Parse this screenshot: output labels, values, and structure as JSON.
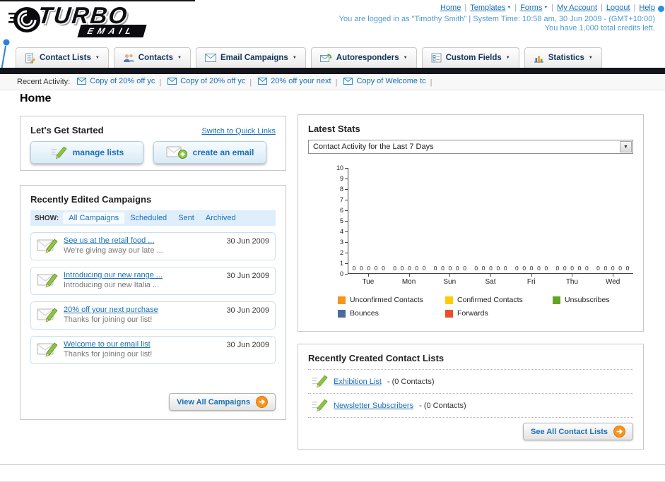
{
  "page_title": "Home",
  "header": {
    "logo_line1": "TURBO",
    "logo_line2": "EMAIL",
    "nav_links": [
      {
        "label": "Home",
        "caret": false
      },
      {
        "label": "Templates",
        "caret": true
      },
      {
        "label": "Forms",
        "caret": true
      },
      {
        "label": "My Account",
        "caret": false
      },
      {
        "label": "Logout",
        "caret": false
      },
      {
        "label": "Help",
        "caret": false
      }
    ],
    "status_line": "You are logged in as \"Timothy Smith\" | System Time: 10:58 am, 30 Jun 2009 - (GMT+10:00)",
    "credits_line": "You have 1,000 total credits left."
  },
  "main_nav": {
    "items": [
      {
        "label": "Contact Lists",
        "icon": "contact-lists"
      },
      {
        "label": "Contacts",
        "icon": "contacts"
      },
      {
        "label": "Email Campaigns",
        "icon": "email-campaigns"
      },
      {
        "label": "Autoresponders",
        "icon": "autoresponders"
      },
      {
        "label": "Custom Fields",
        "icon": "custom-fields"
      },
      {
        "label": "Statistics",
        "icon": "statistics"
      }
    ]
  },
  "recent_activity": {
    "label": "Recent Activity:",
    "items": [
      {
        "label": "Copy of 20% off yc",
        "icon": "envelope-small"
      },
      {
        "label": "Copy of 20% off yc",
        "icon": "envelope-small"
      },
      {
        "label": "20% off your next",
        "icon": "envelope-small"
      },
      {
        "label": "Copy of Welcome tc",
        "icon": "envelope-small"
      }
    ]
  },
  "get_started": {
    "title": "Let's Get Started",
    "switch_link": "Switch to Quick Links",
    "buttons": [
      {
        "label": "manage lists",
        "icon": "pencil-write"
      },
      {
        "label": "create an email",
        "icon": "envelope-plus"
      }
    ]
  },
  "campaigns": {
    "title": "Recently Edited Campaigns",
    "show_label": "SHOW:",
    "tabs": [
      "All Campaigns",
      "Scheduled",
      "Sent",
      "Archived"
    ],
    "active_tab": "All Campaigns",
    "items": [
      {
        "title": "See us at the retail food ...",
        "subtitle": "We're giving away our late ...",
        "date": "30 Jun 2009",
        "icon": "envelope-pencil"
      },
      {
        "title": "Introducing our new range ...",
        "subtitle": "Introducing our new Italia ...",
        "date": "30 Jun 2009",
        "icon": "envelope-pencil"
      },
      {
        "title": "20% off your next purchase",
        "subtitle": "Thanks for joining our list!",
        "date": "30 Jun 2009",
        "icon": "envelope-pencil"
      },
      {
        "title": "Welcome to our email list",
        "subtitle": "Thanks for joining our list!",
        "date": "30 Jun 2009",
        "icon": "envelope-pencil"
      }
    ],
    "view_all_label": "View All Campaigns"
  },
  "latest_stats": {
    "title": "Latest Stats",
    "dropdown_value": "Contact Activity for the Last 7 Days",
    "chart_data": {
      "type": "bar",
      "title": "Contact Activity for the Last 7 Days",
      "categories": [
        "Tue",
        "Mon",
        "Sun",
        "Sat",
        "Fri",
        "Thu",
        "Wed"
      ],
      "series": [
        {
          "name": "Unconfirmed Contacts",
          "color": "#f7941d",
          "values": [
            0,
            0,
            0,
            0,
            0,
            0,
            0
          ]
        },
        {
          "name": "Confirmed Contacts",
          "color": "#ffcb05",
          "values": [
            0,
            0,
            0,
            0,
            0,
            0,
            0
          ]
        },
        {
          "name": "Unsubscribes",
          "color": "#61a521",
          "values": [
            0,
            0,
            0,
            0,
            0,
            0,
            0
          ]
        },
        {
          "name": "Bounces",
          "color": "#4a6d9d",
          "values": [
            0,
            0,
            0,
            0,
            0,
            0,
            0
          ]
        },
        {
          "name": "Forwards",
          "color": "#e8502d",
          "values": [
            0,
            0,
            0,
            0,
            0,
            0,
            0
          ]
        }
      ],
      "ylim": [
        0,
        10
      ],
      "ytick_step": 1,
      "grid": false,
      "legend_position": "bottom",
      "show_value_labels": true
    }
  },
  "contact_lists": {
    "title": "Recently Created Contact Lists",
    "items": [
      {
        "name": "Exhibition List",
        "suffix": "- (0 Contacts)",
        "icon": "pencil-write"
      },
      {
        "name": "Newsletter Subscribers",
        "suffix": "- (0 Contacts)",
        "icon": "pencil-write"
      }
    ],
    "see_all_label": "See All Contact Lists"
  }
}
